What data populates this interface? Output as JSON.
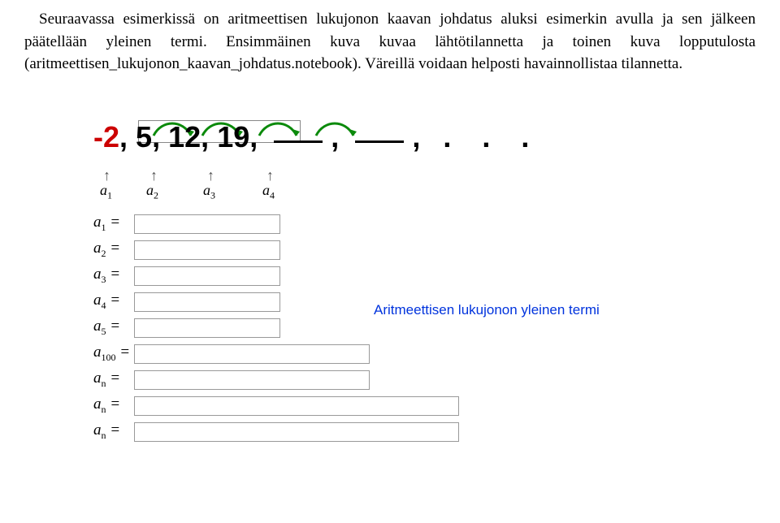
{
  "paragraph": {
    "text": "Seuraavassa esimerkissä on aritmeettisen lukujonon kaavan johdatus aluksi esimerkin avulla ja sen jälkeen päätellään yleinen termi. Ensimmäinen kuva kuvaa lähtötilannetta ja toinen kuva lopputulosta (aritmeettisen_lukujonon_kaavan_johdatus.notebook). Väreillä voidaan helposti havainnollistaa tilannetta."
  },
  "sequence": {
    "t1": "-2",
    "t2": "5",
    "t3": "12",
    "t4": "19",
    "comma": ",",
    "dots": ". . ."
  },
  "sublabels": {
    "a1": "a",
    "s1": "1",
    "a2": "a",
    "s2": "2",
    "a3": "a",
    "s3": "3",
    "a4": "a",
    "s4": "4"
  },
  "eq": {
    "a1": "a",
    "s1": "1",
    "eq": " =",
    "a2": "a",
    "s2": "2",
    "a3": "a",
    "s3": "3",
    "a4": "a",
    "s4": "4",
    "a5": "a",
    "s5": "5",
    "a100": "a",
    "s100": "100",
    "an": "a",
    "sn": "n"
  },
  "blue_text": "Aritmeettisen lukujonon yleinen termi"
}
